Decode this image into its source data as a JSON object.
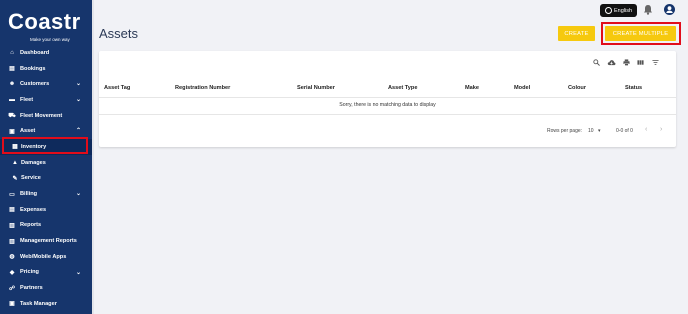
{
  "brand": {
    "name": "Coastr",
    "tagline": "Make your own way"
  },
  "sidebar": {
    "items": [
      {
        "label": "Dashboard",
        "icon": "dashboard-icon",
        "glyph": "⌂"
      },
      {
        "label": "Bookings",
        "icon": "bookings-icon",
        "glyph": "▤"
      },
      {
        "label": "Customers",
        "icon": "customers-icon",
        "glyph": "☻"
      },
      {
        "label": "Fleet",
        "icon": "fleet-icon",
        "glyph": "▬"
      },
      {
        "label": "Fleet Movement",
        "icon": "fleet-movement-icon",
        "glyph": "⛟"
      },
      {
        "label": "Asset",
        "icon": "asset-icon",
        "glyph": "▣"
      },
      {
        "label": "Inventory",
        "icon": "inventory-icon",
        "glyph": "▦"
      },
      {
        "label": "Damages",
        "icon": "damages-icon",
        "glyph": "▲"
      },
      {
        "label": "Service",
        "icon": "service-icon",
        "glyph": "✎"
      },
      {
        "label": "Billing",
        "icon": "billing-icon",
        "glyph": "▭"
      },
      {
        "label": "Expenses",
        "icon": "expenses-icon",
        "glyph": "▤"
      },
      {
        "label": "Reports",
        "icon": "reports-icon",
        "glyph": "▥"
      },
      {
        "label": "Management Reports",
        "icon": "management-reports-icon",
        "glyph": "▥"
      },
      {
        "label": "Web/Mobile Apps",
        "icon": "apps-icon",
        "glyph": "◍"
      },
      {
        "label": "Pricing",
        "icon": "pricing-icon",
        "glyph": "◆"
      },
      {
        "label": "Partners",
        "icon": "partners-icon",
        "glyph": "☍"
      },
      {
        "label": "Task Manager",
        "icon": "task-manager-icon",
        "glyph": "▣"
      }
    ]
  },
  "header": {
    "language": "English",
    "title": "Assets",
    "create_label": "CREATE",
    "create_multiple_label": "CREATE MULTIPLE"
  },
  "table": {
    "columns": [
      "Asset Tag",
      "Registration Number",
      "Serial Number",
      "Asset Type",
      "Make",
      "Model",
      "Colour",
      "Status"
    ],
    "empty_message": "Sorry, there is no matching data to display",
    "rows_per_page_label": "Rows per page:",
    "rows_per_page_value": "10",
    "range": "0-0 of 0"
  },
  "colors": {
    "sidebar": "#16356c",
    "accent": "#f6c90e",
    "highlight": "#e10d1b"
  }
}
